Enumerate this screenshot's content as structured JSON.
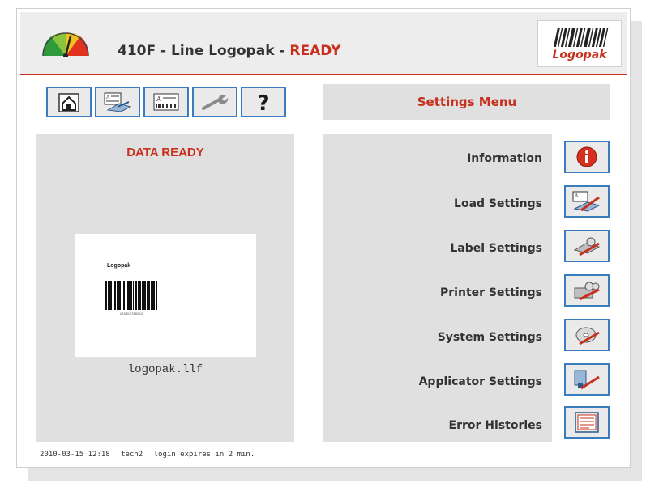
{
  "header": {
    "title_prefix": "410F - Line Logopak - ",
    "status": "READY",
    "logo_text": "Logopak"
  },
  "toolbar": {
    "buttons": [
      "home-icon",
      "load-settings-icon",
      "label-icon",
      "wrench-icon",
      "help-icon"
    ]
  },
  "menu": {
    "title": "Settings Menu",
    "items": [
      {
        "label": "Information",
        "icon": "info-icon"
      },
      {
        "label": "Load Settings",
        "icon": "load-settings-icon"
      },
      {
        "label": "Label Settings",
        "icon": "label-settings-icon"
      },
      {
        "label": "Printer Settings",
        "icon": "printer-settings-icon"
      },
      {
        "label": "System Settings",
        "icon": "system-settings-icon"
      },
      {
        "label": "Applicator Settings",
        "icon": "applicator-settings-icon"
      },
      {
        "label": "Error Histories",
        "icon": "error-histories-icon"
      }
    ]
  },
  "data_panel": {
    "status": "DATA READY",
    "label_company": "Logopak",
    "label_barcode_number": "123456789012",
    "filename": "logopak.llf"
  },
  "statusbar": {
    "datetime": "2010-03-15 12:18",
    "user": "tech2",
    "message": "login expires in 2 min."
  },
  "colors": {
    "accent_red": "#c8301e",
    "button_border": "#3a7cc0",
    "panel_gray": "#e0e0e0"
  }
}
